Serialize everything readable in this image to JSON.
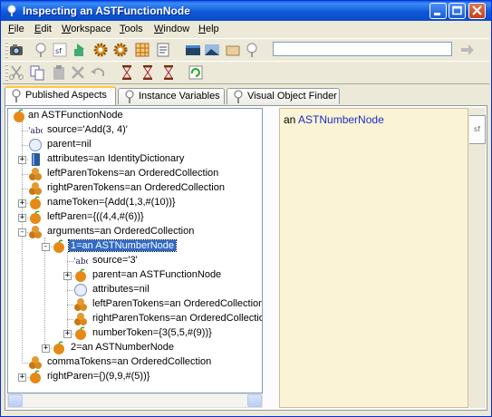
{
  "window": {
    "title": "Inspecting an ASTFunctionNode"
  },
  "menu": [
    {
      "label": "File",
      "u": "F",
      "rest": "ile"
    },
    {
      "label": "Edit",
      "u": "E",
      "rest": "dit"
    },
    {
      "label": "Workspace",
      "u": "W",
      "rest": "orkspace"
    },
    {
      "label": "Tools",
      "u": "T",
      "rest": "ools"
    },
    {
      "label": "Window",
      "u": "W",
      "rest": "indow"
    },
    {
      "label": "Help",
      "u": "H",
      "rest": "elp"
    }
  ],
  "toolbar": {
    "search_value": ""
  },
  "tabs": [
    {
      "label": "Published Aspects",
      "active": true
    },
    {
      "label": "Instance Variables",
      "active": false
    },
    {
      "label": "Visual Object Finder",
      "active": false
    }
  ],
  "tree": {
    "root": "an ASTFunctionNode",
    "items": [
      {
        "label": "source='Add(3, 4)'",
        "icon": "string-icon"
      },
      {
        "label": "parent=nil",
        "icon": "nil-icon"
      },
      {
        "label": "attributes=an IdentityDictionary",
        "icon": "dictionary-icon"
      },
      {
        "label": "leftParenTokens=an OrderedCollection",
        "icon": "collection-icon"
      },
      {
        "label": "rightParenTokens=an OrderedCollection",
        "icon": "collection-icon"
      },
      {
        "label": "nameToken={Add(1,3,#(10))}",
        "icon": "object-icon"
      },
      {
        "label": "leftParen={((4,4,#(6))}",
        "icon": "object-icon"
      },
      {
        "label": "arguments=an OrderedCollection",
        "icon": "collection-icon"
      },
      {
        "label": "1=an ASTNumberNode",
        "icon": "object-icon"
      },
      {
        "label": "source='3'",
        "icon": "string-icon"
      },
      {
        "label": "parent=an ASTFunctionNode",
        "icon": "object-icon"
      },
      {
        "label": "attributes=nil",
        "icon": "nil-icon"
      },
      {
        "label": "leftParenTokens=an OrderedCollection",
        "icon": "collection-icon"
      },
      {
        "label": "rightParenTokens=an OrderedCollection",
        "icon": "collection-icon"
      },
      {
        "label": "numberToken={3(5,5,#(9))}",
        "icon": "object-icon"
      },
      {
        "label": "2=an ASTNumberNode",
        "icon": "object-icon"
      },
      {
        "label": "commaTokens=an OrderedCollection",
        "icon": "collection-icon"
      },
      {
        "label": "rightParen={)(9,9,#(5))}",
        "icon": "object-icon"
      }
    ]
  },
  "detail": {
    "prefix": "an",
    "class_name": "ASTNumberNode",
    "side_tab": "sf"
  },
  "colors": {
    "title_bar": "#0a5ce6",
    "selection": "#316ac5",
    "detail_bg": "#fbf3d5",
    "class_link": "#1a2fc8"
  }
}
